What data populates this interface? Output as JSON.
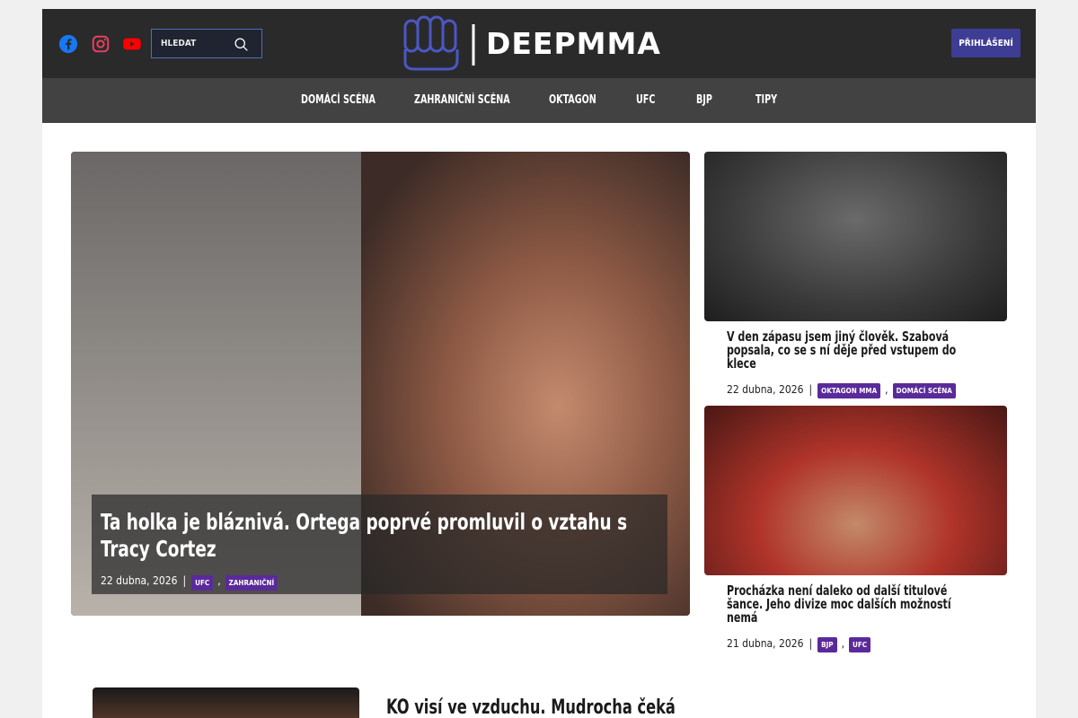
{
  "header": {
    "social": [
      {
        "name": "facebook-icon",
        "color": "#1877f2"
      },
      {
        "name": "instagram-icon",
        "color": "#e4405f"
      },
      {
        "name": "youtube-icon",
        "color": "#ff0000"
      }
    ],
    "search": {
      "placeholder": "HLEDAT"
    },
    "logo_text": "DEEPMMA",
    "login_label": "Přihlášení",
    "accent_color": "#3e3d95"
  },
  "nav": {
    "items": [
      "Domácí scéna",
      "Zahraniční scéna",
      "Oktagon",
      "UFC",
      "BJP",
      "Tipy"
    ]
  },
  "hero": {
    "title": "Ta holka je bláznivá. Ortega poprvé promluvil o vztahu s Tracy Cortez",
    "date": "22 dubna, 2026",
    "tags": [
      "UFC",
      "Zahraniční"
    ]
  },
  "side": [
    {
      "title": "V den zápasu jsem jiný člověk. Szabová popsala, co se s ní děje před vstupem do klece",
      "date": "22 dubna, 2026",
      "tags": [
        "Oktagon MMA",
        "Domácí scéna"
      ]
    },
    {
      "title": "Procházka není daleko od další titulové šance. Jeho divize moc dalších možností nemá",
      "date": "21 dubna, 2026",
      "tags": [
        "BJP",
        "UFC"
      ]
    }
  ],
  "teaser": {
    "title": "KO visí ve vzduchu. Mudrocha čeká"
  },
  "tag_color": "#5a2a9a"
}
